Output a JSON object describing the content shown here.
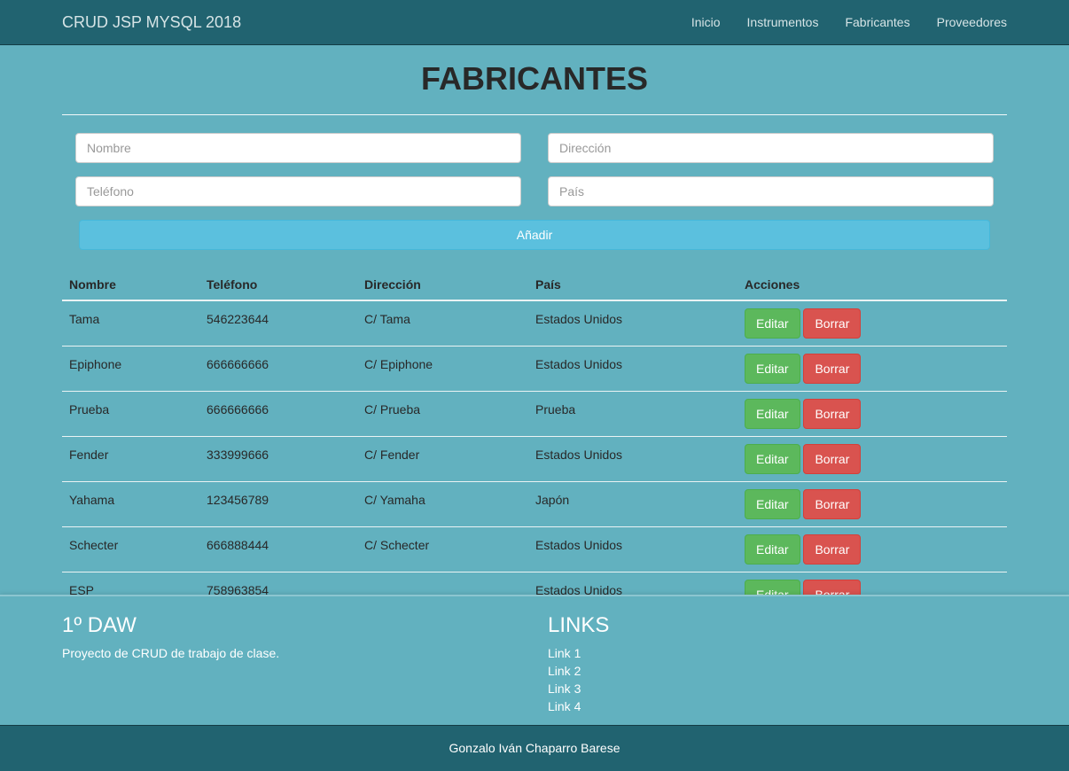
{
  "navbar": {
    "brand": "CRUD JSP MYSQL 2018",
    "links": [
      "Inicio",
      "Instrumentos",
      "Fabricantes",
      "Proveedores"
    ]
  },
  "page": {
    "title": "FABRICANTES"
  },
  "form": {
    "nombre_placeholder": "Nombre",
    "direccion_placeholder": "Dirección",
    "telefono_placeholder": "Teléfono",
    "pais_placeholder": "País",
    "add_label": "Añadir"
  },
  "table": {
    "headers": [
      "Nombre",
      "Teléfono",
      "Dirección",
      "País",
      "Acciones"
    ],
    "edit_label": "Editar",
    "delete_label": "Borrar",
    "rows": [
      {
        "nombre": "Tama",
        "telefono": "546223644",
        "direccion": "C/ Tama",
        "pais": "Estados Unidos"
      },
      {
        "nombre": "Epiphone",
        "telefono": "666666666",
        "direccion": "C/ Epiphone",
        "pais": "Estados Unidos"
      },
      {
        "nombre": "Prueba",
        "telefono": "666666666",
        "direccion": "C/ Prueba",
        "pais": "Prueba"
      },
      {
        "nombre": "Fender",
        "telefono": "333999666",
        "direccion": "C/ Fender",
        "pais": "Estados Unidos"
      },
      {
        "nombre": "Yahama",
        "telefono": "123456789",
        "direccion": "C/ Yamaha",
        "pais": "Japón"
      },
      {
        "nombre": "Schecter",
        "telefono": "666888444",
        "direccion": "C/ Schecter",
        "pais": "Estados Unidos"
      },
      {
        "nombre": "ESP",
        "telefono": "758963854",
        "direccion": "",
        "pais": "Estados Unidos"
      }
    ]
  },
  "footer": {
    "about_title": "1º DAW",
    "about_text": "Proyecto de CRUD de trabajo de clase.",
    "links_title": "LINKS",
    "links": [
      "Link 1",
      "Link 2",
      "Link 3",
      "Link 4"
    ],
    "credit": "Gonzalo Iván Chaparro Barese"
  },
  "colors": {
    "navbar": "#216370",
    "background": "#62b1bf",
    "add_button": "#5bc0de",
    "edit_button": "#5cb85c",
    "delete_button": "#d9534f"
  }
}
